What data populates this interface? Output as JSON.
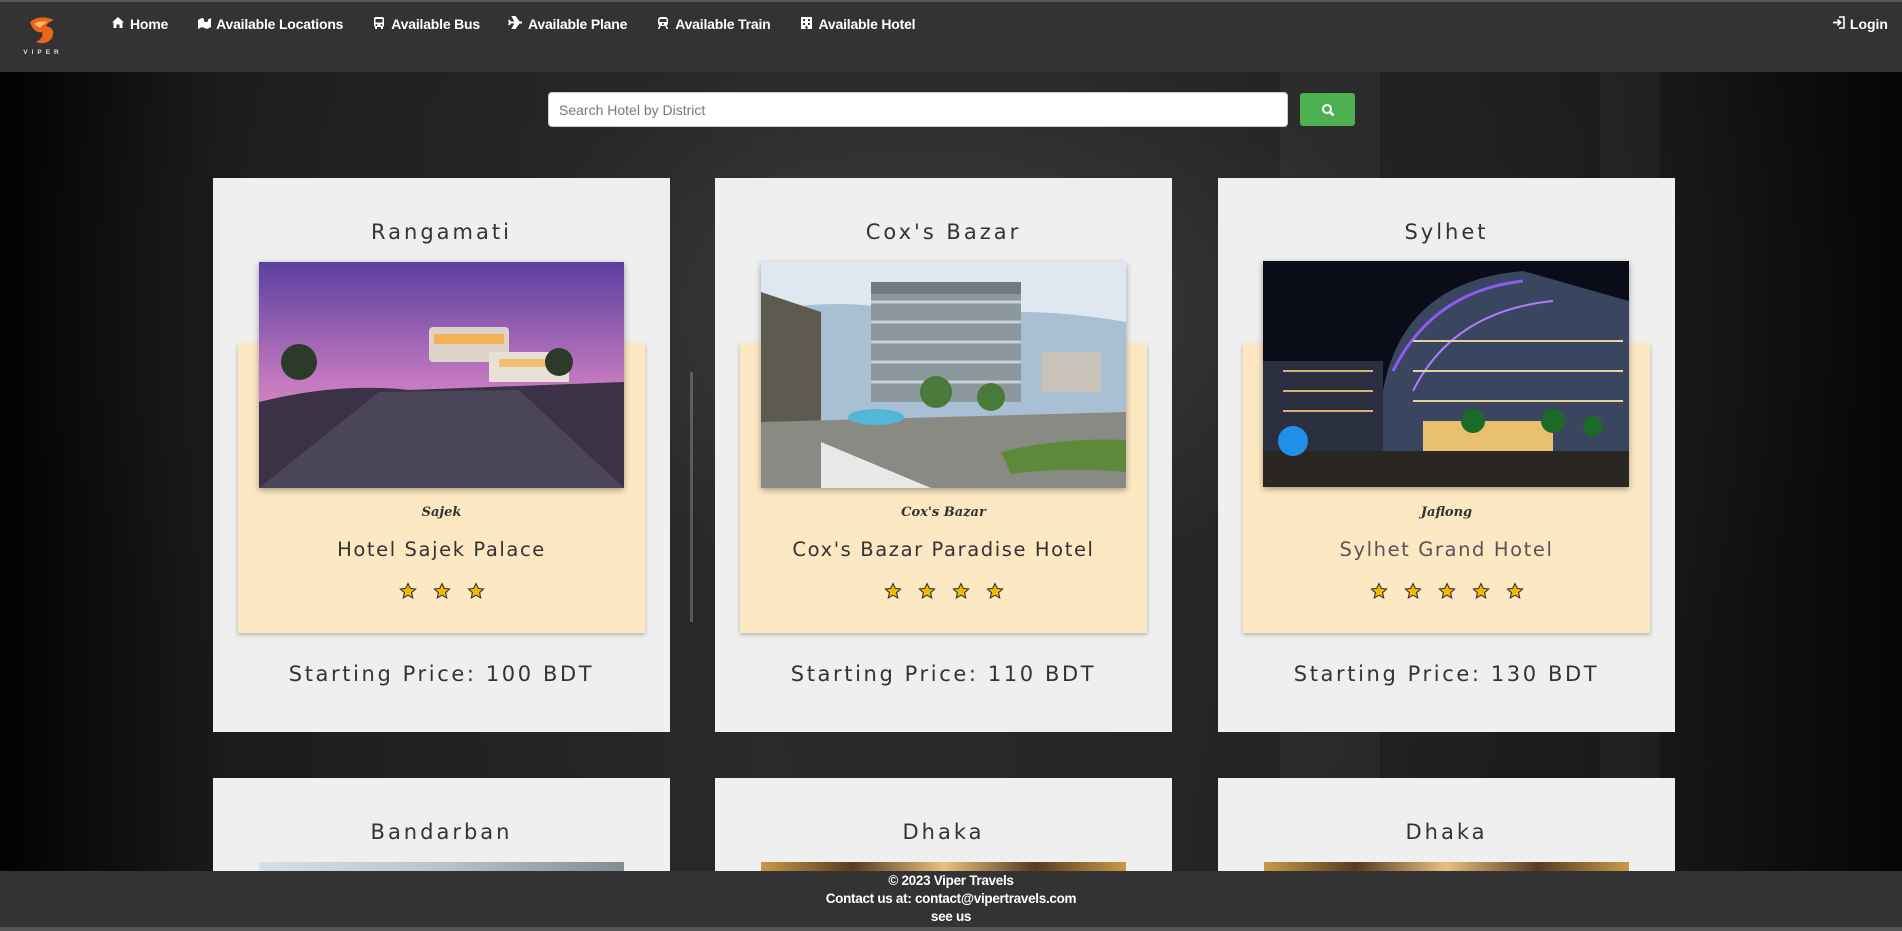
{
  "brand": {
    "name": "VIPER"
  },
  "nav": {
    "items": [
      {
        "label": "Home",
        "icon": "home-icon"
      },
      {
        "label": "Available Locations",
        "icon": "locations-icon"
      },
      {
        "label": "Available Bus",
        "icon": "bus-icon"
      },
      {
        "label": "Available Plane",
        "icon": "plane-icon"
      },
      {
        "label": "Available Train",
        "icon": "train-icon"
      },
      {
        "label": "Available Hotel",
        "icon": "hotel-icon"
      }
    ],
    "login_label": "Login"
  },
  "search": {
    "placeholder": "Search Hotel by District",
    "value": ""
  },
  "colors": {
    "navbar": "#333333",
    "search_button": "#4caf50",
    "card": "#efefef",
    "panel": "#fde8c4",
    "star": "#f5b800"
  },
  "hotels": [
    {
      "district": "Rangamati",
      "place": "Sajek",
      "name": "Hotel Sajek Palace",
      "stars": 3,
      "price": "Starting Price: 100 BDT"
    },
    {
      "district": "Cox's Bazar",
      "place": "Cox's Bazar",
      "name": "Cox's Bazar Paradise Hotel",
      "stars": 4,
      "price": "Starting Price: 110 BDT"
    },
    {
      "district": "Sylhet",
      "place": "Jaflong",
      "name": "Sylhet Grand Hotel",
      "stars": 5,
      "price": "Starting Price: 130 BDT"
    },
    {
      "district": "Bandarban"
    },
    {
      "district": "Dhaka"
    },
    {
      "district": "Dhaka"
    }
  ],
  "footer": {
    "copyright": "© 2023 Viper Travels",
    "contact": "Contact us at: contact@vipertravels.com",
    "see_us": "see us"
  }
}
